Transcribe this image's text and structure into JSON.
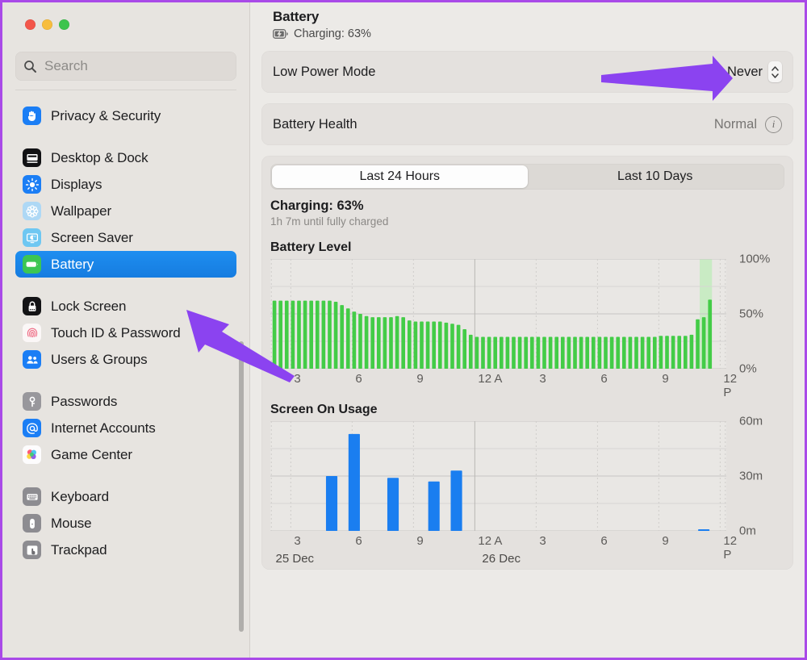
{
  "window": {
    "traffic_lights": [
      "close-red",
      "minimize-yellow",
      "maximize-green"
    ],
    "border_color": "#a94ae8"
  },
  "sidebar": {
    "search": {
      "placeholder": "Search",
      "value": "",
      "icon": "search-icon"
    },
    "items": [
      {
        "label": "Privacy & Security",
        "icon": "hand-shield-icon",
        "selected": false,
        "gap_before": false
      },
      {
        "label": "Desktop & Dock",
        "icon": "desktop-dock-icon",
        "selected": false,
        "gap_before": true
      },
      {
        "label": "Displays",
        "icon": "brightness-icon",
        "selected": false,
        "gap_before": false
      },
      {
        "label": "Wallpaper",
        "icon": "wallpaper-flower-icon",
        "selected": false,
        "gap_before": false
      },
      {
        "label": "Screen Saver",
        "icon": "screen-saver-icon",
        "selected": false,
        "gap_before": false
      },
      {
        "label": "Battery",
        "icon": "battery-icon",
        "selected": true,
        "gap_before": false
      },
      {
        "label": "Lock Screen",
        "icon": "lock-screen-icon",
        "selected": false,
        "gap_before": true
      },
      {
        "label": "Touch ID & Password",
        "icon": "fingerprint-icon",
        "selected": false,
        "gap_before": false
      },
      {
        "label": "Users & Groups",
        "icon": "users-groups-icon",
        "selected": false,
        "gap_before": false
      },
      {
        "label": "Passwords",
        "icon": "key-icon",
        "selected": false,
        "gap_before": true
      },
      {
        "label": "Internet Accounts",
        "icon": "at-sign-icon",
        "selected": false,
        "gap_before": false
      },
      {
        "label": "Game Center",
        "icon": "game-center-icon",
        "selected": false,
        "gap_before": false
      },
      {
        "label": "Keyboard",
        "icon": "keyboard-icon",
        "selected": false,
        "gap_before": true
      },
      {
        "label": "Mouse",
        "icon": "mouse-icon",
        "selected": false,
        "gap_before": false
      },
      {
        "label": "Trackpad",
        "icon": "trackpad-icon",
        "selected": false,
        "gap_before": false
      }
    ]
  },
  "main": {
    "page_title": "Battery",
    "charge_status": "Charging: 63%",
    "charge_status_icon": "battery-charging-icon",
    "low_power_mode": {
      "label": "Low Power Mode",
      "value": "Never",
      "control": "popup-stepper"
    },
    "battery_health": {
      "label": "Battery Health",
      "value": "Normal",
      "info_icon": "info-circle-icon",
      "info_glyph": "i"
    },
    "tabs": [
      {
        "label": "Last 24 Hours",
        "active": true
      },
      {
        "label": "Last 10 Days",
        "active": false
      }
    ],
    "status": {
      "title": "Charging: 63%",
      "subtitle": "1h 7m until fully charged"
    }
  },
  "annotations": {
    "arrow_color": "#8b43f0",
    "arrows": [
      {
        "name": "arrow-to-low-power-value",
        "from": [
          742,
          94
        ],
        "to": [
          900,
          94
        ]
      },
      {
        "name": "arrow-to-battery-sidebar-item",
        "from": [
          360,
          460
        ],
        "to": [
          228,
          382
        ]
      }
    ]
  },
  "chart_data": [
    {
      "type": "bar",
      "title": "Battery Level",
      "xlabel": "",
      "ylabel": "",
      "ylim": [
        0,
        100
      ],
      "ytick_labels": [
        "100%",
        "50%",
        "0%"
      ],
      "ytick_values": [
        100,
        50,
        0
      ],
      "xtick_labels": [
        "3",
        "6",
        "9",
        "12 A",
        "3",
        "6",
        "9",
        "12 P"
      ],
      "xtick_hours": [
        3,
        6,
        9,
        12,
        15,
        18,
        21,
        24
      ],
      "grid": true,
      "bar_color": "#43cc47",
      "highlight_band": {
        "start_hour": 23.0,
        "end_hour": 23.6,
        "color": "#c9ebc4",
        "label": "charging-period"
      },
      "charging_marker": {
        "hour": 23.3,
        "color": "#43cc47"
      },
      "x_hours": [
        2.2,
        2.5,
        2.8,
        3.1,
        3.4,
        3.7,
        4.0,
        4.3,
        4.6,
        4.9,
        5.2,
        5.5,
        5.8,
        6.1,
        6.4,
        6.7,
        7.0,
        7.3,
        7.6,
        7.9,
        8.2,
        8.5,
        8.8,
        9.1,
        9.4,
        9.7,
        10.0,
        10.3,
        10.6,
        10.9,
        11.2,
        11.5,
        11.8,
        12.1,
        12.4,
        12.7,
        13.0,
        13.3,
        13.6,
        13.9,
        14.2,
        14.5,
        14.8,
        15.1,
        15.4,
        15.7,
        16.0,
        16.3,
        16.6,
        16.9,
        17.2,
        17.5,
        17.8,
        18.1,
        18.4,
        18.7,
        19.0,
        19.3,
        19.6,
        19.9,
        20.2,
        20.5,
        20.8,
        21.1,
        21.4,
        21.7,
        22.0,
        22.3,
        22.6,
        22.9,
        23.2,
        23.5
      ],
      "values": [
        62,
        62,
        62,
        62,
        62,
        62,
        62,
        62,
        62,
        62,
        61,
        58,
        55,
        52,
        50,
        48,
        47,
        47,
        47,
        47,
        48,
        47,
        44,
        43,
        43,
        43,
        43,
        43,
        42,
        41,
        40,
        36,
        31,
        29,
        29,
        29,
        29,
        29,
        29,
        29,
        29,
        29,
        29,
        29,
        29,
        29,
        29,
        29,
        29,
        29,
        29,
        29,
        29,
        29,
        29,
        29,
        29,
        29,
        29,
        29,
        29,
        29,
        29,
        30,
        30,
        30,
        30,
        30,
        31,
        45,
        47,
        63
      ]
    },
    {
      "type": "bar",
      "title": "Screen On Usage",
      "xlabel": "",
      "ylabel": "",
      "ylim": [
        0,
        60
      ],
      "ytick_labels": [
        "60m",
        "30m",
        "0m"
      ],
      "ytick_values": [
        60,
        30,
        0
      ],
      "xtick_labels": [
        "3",
        "6",
        "9",
        "12 A",
        "3",
        "6",
        "9",
        "12 P"
      ],
      "xtick_hours": [
        3,
        6,
        9,
        12,
        15,
        18,
        21,
        24
      ],
      "date_labels": [
        {
          "text": "25 Dec",
          "hour": 2.1
        },
        {
          "text": "26 Dec",
          "hour": 12.2
        }
      ],
      "grid": true,
      "bar_color": "#1a7ef0",
      "x_hours": [
        5.0,
        6.1,
        8.0,
        10.0,
        11.1,
        23.2
      ],
      "values": [
        30,
        53,
        29,
        27,
        33,
        0.6
      ],
      "units": "minutes"
    }
  ]
}
